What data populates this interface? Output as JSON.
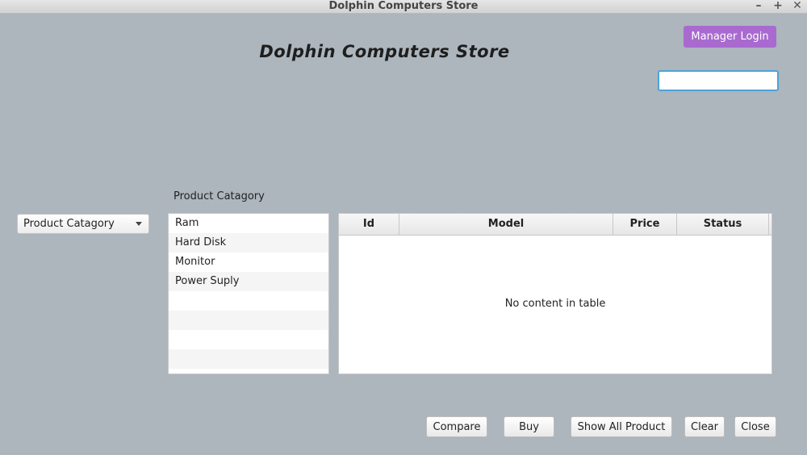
{
  "window": {
    "title": "Dolphin Computers Store",
    "controls": [
      "–",
      "+",
      "✕"
    ]
  },
  "header": {
    "title": "Dolphin Computers Store",
    "manager_login_label": "Manager Login",
    "search_value": "",
    "accent_color": "#a96ad0"
  },
  "category": {
    "section_label": "Product Catagory",
    "combo_value": "Product Catagory",
    "items": [
      "Ram",
      "Hard Disk",
      "Monitor",
      "Power Suply",
      "",
      "",
      "",
      ""
    ]
  },
  "table": {
    "columns": [
      "Id",
      "Model",
      "Price",
      "Status"
    ],
    "rows": [],
    "empty_message": "No content in table"
  },
  "actions": {
    "compare": "Compare",
    "buy": "Buy",
    "show_all": "Show All Product",
    "clear": "Clear",
    "close": "Close"
  }
}
